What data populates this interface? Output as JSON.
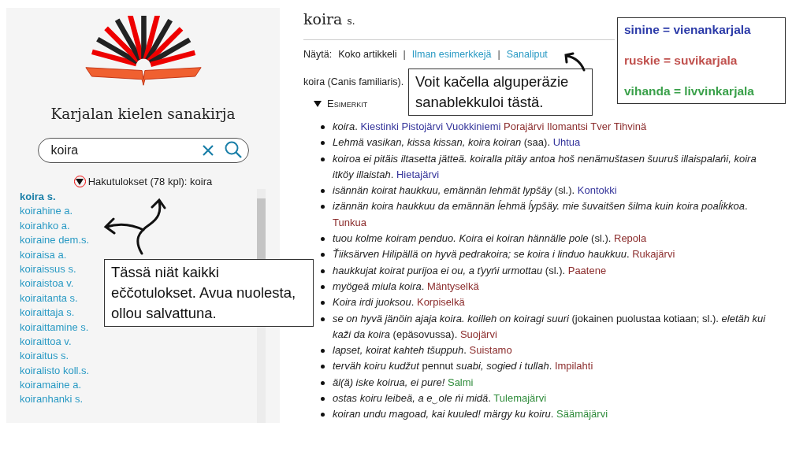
{
  "sidebar": {
    "title": "Karjalan kielen sanakirja",
    "search": {
      "value": "koira"
    },
    "results_header": {
      "expanded": true,
      "label": "Hakutulokset (78 kpl): koira"
    },
    "results": [
      {
        "label": "koira s.",
        "selected": true
      },
      {
        "label": "koirahine a.",
        "selected": false
      },
      {
        "label": "koirahko a.",
        "selected": false
      },
      {
        "label": "koiraine dem.s.",
        "selected": false
      },
      {
        "label": "koiraisa a.",
        "selected": false
      },
      {
        "label": "koiraissus s.",
        "selected": false
      },
      {
        "label": "koiraistoa v.",
        "selected": false
      },
      {
        "label": "koiraitanta s.",
        "selected": false
      },
      {
        "label": "koiraittaja s.",
        "selected": false
      },
      {
        "label": "koiraittamine s.",
        "selected": false
      },
      {
        "label": "koiraittoa v.",
        "selected": false
      },
      {
        "label": "koiraitus s.",
        "selected": false
      },
      {
        "label": "koiralisto koll.s.",
        "selected": false
      },
      {
        "label": "koiramaine a.",
        "selected": false
      },
      {
        "label": "koiranhanki s.",
        "selected": false
      }
    ]
  },
  "article": {
    "headword": "koira",
    "pos": "s.",
    "view": {
      "label": "Näytä:",
      "separators": [
        "|",
        "|"
      ],
      "options": [
        {
          "label": "Koko artikkeli",
          "selected": true
        },
        {
          "label": "Ilman esimerkkejä",
          "selected": false
        },
        {
          "label": "Sanaliput",
          "selected": false
        }
      ]
    },
    "definition": "koira (Canis familiaris).",
    "examples_header": {
      "label": "Esimerkit",
      "expanded": true
    },
    "examples": [
      {
        "text": "*koira*.",
        "places": [
          {
            "text": "Kiestinki Pistojärvi Vuokkiniemi",
            "color": "#33339a"
          },
          {
            "text": "Porajärvi Ilomantsi Tver Tihvinä",
            "color": "#8b2c2c"
          }
        ]
      },
      {
        "text": "*Lehmä vasikan, kissa kissan, koira koiran* (saa).",
        "places": [
          {
            "text": "Uhtua",
            "color": "#33339a"
          }
        ]
      },
      {
        "text": "*koiroa ei pitäis iltasetta jätteä. koiralla pitäy antoa hoš nenämuštasen šuuruš illaispalańi, koira itköy illaistah*.",
        "places": [
          {
            "text": "Hietajärvi",
            "color": "#33339a"
          }
        ]
      },
      {
        "text": "*isännän koirat haukkuu, emännän lehmät lypšäy* (sl.).",
        "places": [
          {
            "text": "Kontokki",
            "color": "#33339a"
          }
        ]
      },
      {
        "text": "*izännän koira haukkuu da emännän ĺehmä ĺypšäy. mie šuvaitšen šilma kuin koira poaĺikkoa*.",
        "places": [
          {
            "text": "Tunkua",
            "color": "#8b2c2c"
          }
        ]
      },
      {
        "text": "*tuou kolme koiram penduo. Koira ei koiran hännälle pole* (sl.).",
        "places": [
          {
            "text": "Repola",
            "color": "#8b2c2c"
          }
        ]
      },
      {
        "text": "*Ťiiksärven Hilipällä on hyvä pedrakoira; se koira i linduo haukkuu*.",
        "places": [
          {
            "text": "Rukajärvi",
            "color": "#8b2c2c"
          }
        ]
      },
      {
        "text": "*haukkujat koirat purijoa ei ou, a ťyyńi urmottau* (sl.).",
        "places": [
          {
            "text": "Paatene",
            "color": "#8b2c2c"
          }
        ]
      },
      {
        "text": "*myögeä miula koira*.",
        "places": [
          {
            "text": "Mäntyselkä",
            "color": "#8b2c2c"
          }
        ]
      },
      {
        "text": "*Koira irdi juoksou*.",
        "places": [
          {
            "text": "Korpiselkä",
            "color": "#8b2c2c"
          }
        ]
      },
      {
        "text": "*se on hyvä jänöin ajaja koira. koilleh on koiragi suuri* (jokainen puolustaa kotiaan; sl.). *eletäh kui kaži da koira* (epäsovussa).",
        "places": [
          {
            "text": "Suojärvi",
            "color": "#8b2c2c"
          }
        ]
      },
      {
        "text": "*lapset, koirat kahteh tšuppuh*.",
        "places": [
          {
            "text": "Suistamo",
            "color": "#8b2c2c"
          }
        ]
      },
      {
        "text": "*terväh koiru kudžut* pennut *suabi, sogied i tullah*.",
        "places": [
          {
            "text": "Impilahti",
            "color": "#8b2c2c"
          }
        ]
      },
      {
        "text": "*äl(ä) iske koirua, ei pure!*",
        "places": [
          {
            "text": "Salmi",
            "color": "#2e8b3a"
          }
        ]
      },
      {
        "text": "*ostas koiru leibeä, a e‿ole ńi midä*.",
        "places": [
          {
            "text": "Tulemajärvi",
            "color": "#2e8b3a"
          }
        ]
      },
      {
        "text": "*koiran undu magoad, kai kuuled! märgy ku koiru*.",
        "places": [
          {
            "text": "Säämäjärvi",
            "color": "#2e8b3a"
          }
        ]
      }
    ]
  },
  "legend": [
    {
      "text": "sinine = vienankarjala",
      "color": "#2b3aa8"
    },
    {
      "text": "ruskie = suvikarjala",
      "color": "#c0504d"
    },
    {
      "text": "vihanda = livvinkarjala",
      "color": "#3aa04a"
    }
  ],
  "callouts": [
    {
      "text": "Tässä niät kaikki eččotulokset. Avua nuolesta, ollou salvattuna."
    },
    {
      "text": "Voit kačella alguperäzie sanablekkuloi tästä."
    }
  ]
}
